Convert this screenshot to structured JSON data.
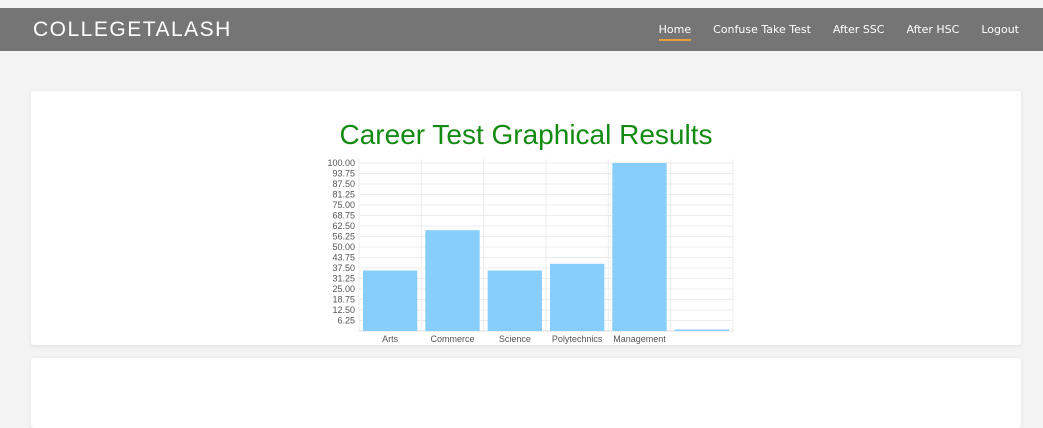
{
  "app": {
    "brand": "COLLEGETALASH"
  },
  "nav": {
    "items": [
      {
        "label": "Home",
        "active": true
      },
      {
        "label": "Confuse Take Test",
        "active": false
      },
      {
        "label": "After SSC",
        "active": false
      },
      {
        "label": "After HSC",
        "active": false
      },
      {
        "label": "Logout",
        "active": false
      }
    ]
  },
  "colors": {
    "navbar": "#757575",
    "accent_underline": "#e8a13a",
    "title": "#138b13",
    "bar": "#87cefa"
  },
  "chart_data": {
    "type": "bar",
    "title": "Career Test Graphical Results",
    "categories": [
      "Arts",
      "Commerce",
      "Science",
      "Polytechnics",
      "Management",
      ""
    ],
    "values": [
      36,
      60,
      36,
      40,
      100,
      0
    ],
    "yticks": [
      "100.00",
      "93.75",
      "87.50",
      "81.25",
      "75.00",
      "68.75",
      "62.50",
      "56.25",
      "50.00",
      "43.75",
      "37.50",
      "31.25",
      "25.00",
      "18.75",
      "12.50",
      "6.25"
    ],
    "ylim": [
      0,
      100
    ],
    "grid": true,
    "xlabel": "",
    "ylabel": ""
  }
}
